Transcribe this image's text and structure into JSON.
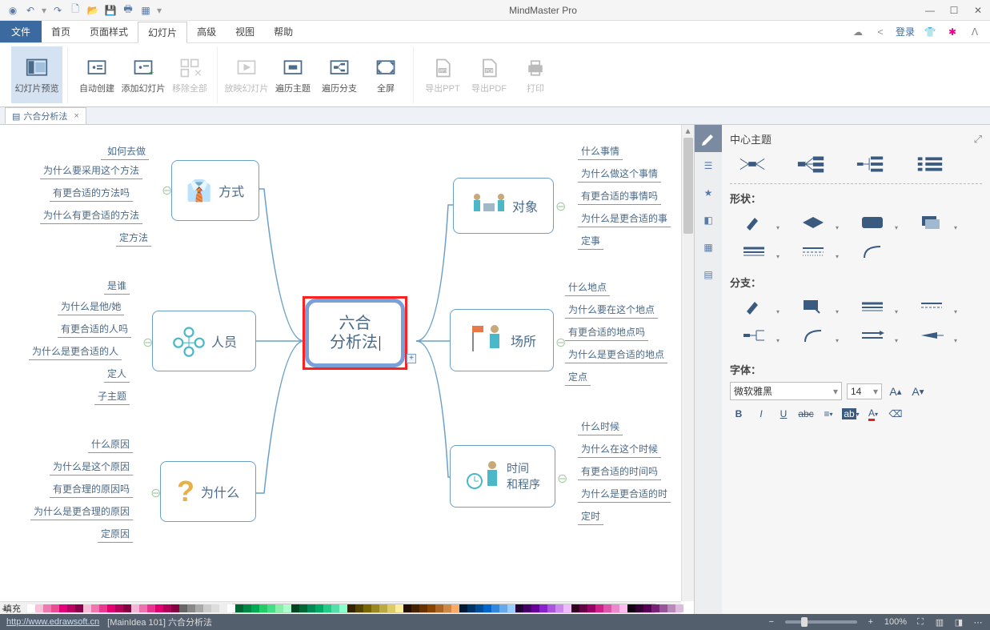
{
  "app_title": "MindMaster Pro",
  "qat_icons": [
    "globe-icon",
    "undo-icon",
    "redo-icon",
    "new-icon",
    "open-icon",
    "save-icon",
    "print-icon",
    "options-icon"
  ],
  "menu": {
    "file": "文件",
    "tabs": [
      "首页",
      "页面样式",
      "幻灯片",
      "高级",
      "视图",
      "帮助"
    ],
    "active_index": 2,
    "login": "登录"
  },
  "ribbon": {
    "groups": [
      {
        "id": "preview",
        "items": [
          {
            "icon": "slideshow-panel",
            "label": "幻灯片预览",
            "active": true
          }
        ]
      },
      {
        "id": "create",
        "items": [
          {
            "icon": "auto-create",
            "label": "自动创建"
          },
          {
            "icon": "add-slide",
            "label": "添加幻灯片"
          },
          {
            "icon": "remove-all",
            "label": "移除全部",
            "disabled": true
          }
        ]
      },
      {
        "id": "play",
        "items": [
          {
            "icon": "play-slideshow",
            "label": "放映幻灯片",
            "disabled": true
          },
          {
            "icon": "traverse-topic",
            "label": "遍历主题"
          },
          {
            "icon": "traverse-branch",
            "label": "遍历分支"
          },
          {
            "icon": "fullscreen",
            "label": "全屏"
          }
        ]
      },
      {
        "id": "export",
        "items": [
          {
            "icon": "export-ppt",
            "label": "导出PPT",
            "disabled": true
          },
          {
            "icon": "export-pdf",
            "label": "导出PDF",
            "disabled": true
          },
          {
            "icon": "print",
            "label": "打印",
            "disabled": true
          }
        ]
      }
    ]
  },
  "doc_tab": {
    "icon": "doc-icon",
    "label": "六合分析法"
  },
  "mindmap": {
    "center": "六合\n分析法",
    "branches": {
      "method": {
        "title": "方式",
        "subs": [
          "如何去做",
          "为什么要采用这个方法",
          "有更合适的方法吗",
          "为什么有更合适的方法",
          "定方法"
        ]
      },
      "people": {
        "title": "人员",
        "subs": [
          "是谁",
          "为什么是他/她",
          "有更合适的人吗",
          "为什么是更合适的人",
          "定人",
          "子主题"
        ]
      },
      "why": {
        "title": "为什么",
        "subs": [
          "什么原因",
          "为什么是这个原因",
          "有更合理的原因吗",
          "为什么是更合理的原因",
          "定原因"
        ]
      },
      "object": {
        "title": "对象",
        "subs": [
          "什么事情",
          "为什么做这个事情",
          "有更合适的事情吗",
          "为什么是更合适的事",
          "定事"
        ]
      },
      "place": {
        "title": "场所",
        "subs": [
          "什么地点",
          "为什么要在这个地点",
          "有更合适的地点吗",
          "为什么是更合适的地点",
          "定点"
        ]
      },
      "time": {
        "title": "时间\n和程序",
        "subs": [
          "什么时候",
          "为什么在这个时候",
          "有更合适的时间吗",
          "为什么是更合适的时",
          "定时"
        ]
      }
    }
  },
  "sidepanel": {
    "title": "中心主题",
    "shape_label": "形状：",
    "branch_label": "分支：",
    "font_label": "字体：",
    "font_family": "微软雅黑",
    "font_size": "14"
  },
  "palette_label": "填充",
  "palette_colors": [
    "#ffffff",
    "#f7c2d9",
    "#ef7ab0",
    "#e94e94",
    "#e3007b",
    "#b70062",
    "#8b004a",
    "#f6bcd8",
    "#ee77b0",
    "#e7398f",
    "#e0006e",
    "#b30058",
    "#860042",
    "#f4b6d6",
    "#ec72af",
    "#e5358f",
    "#de006e",
    "#b20058",
    "#860042",
    "#666666",
    "#888888",
    "#aaaaaa",
    "#cccccc",
    "#dddddd",
    "#eeeeee",
    "#ffffff",
    "#006633",
    "#008844",
    "#00aa55",
    "#22cc66",
    "#44dd88",
    "#88eeaa",
    "#aaffcc",
    "#004422",
    "#006633",
    "#008855",
    "#00aa66",
    "#22cc88",
    "#55ddaa",
    "#88ffcc",
    "#332200",
    "#554400",
    "#776600",
    "#998822",
    "#bbaa44",
    "#ddcc66",
    "#ffee99",
    "#221100",
    "#442200",
    "#663300",
    "#884400",
    "#aa6622",
    "#cc8844",
    "#ffaa66",
    "#001a33",
    "#003366",
    "#004c99",
    "#0066cc",
    "#3388dd",
    "#66aaee",
    "#99ccff",
    "#220033",
    "#440066",
    "#660099",
    "#8822cc",
    "#aa55dd",
    "#cc88ee",
    "#eebbff",
    "#330022",
    "#660044",
    "#990066",
    "#cc2288",
    "#dd55aa",
    "#ee88cc",
    "#ffbbee",
    "#110011",
    "#330033",
    "#550055",
    "#772277",
    "#995599",
    "#bb88bb",
    "#ddbbdd"
  ],
  "status": {
    "url": "http://www.edrawsoft.cn",
    "context": "[MainIdea 101]  六合分析法",
    "zoom": "100%"
  }
}
